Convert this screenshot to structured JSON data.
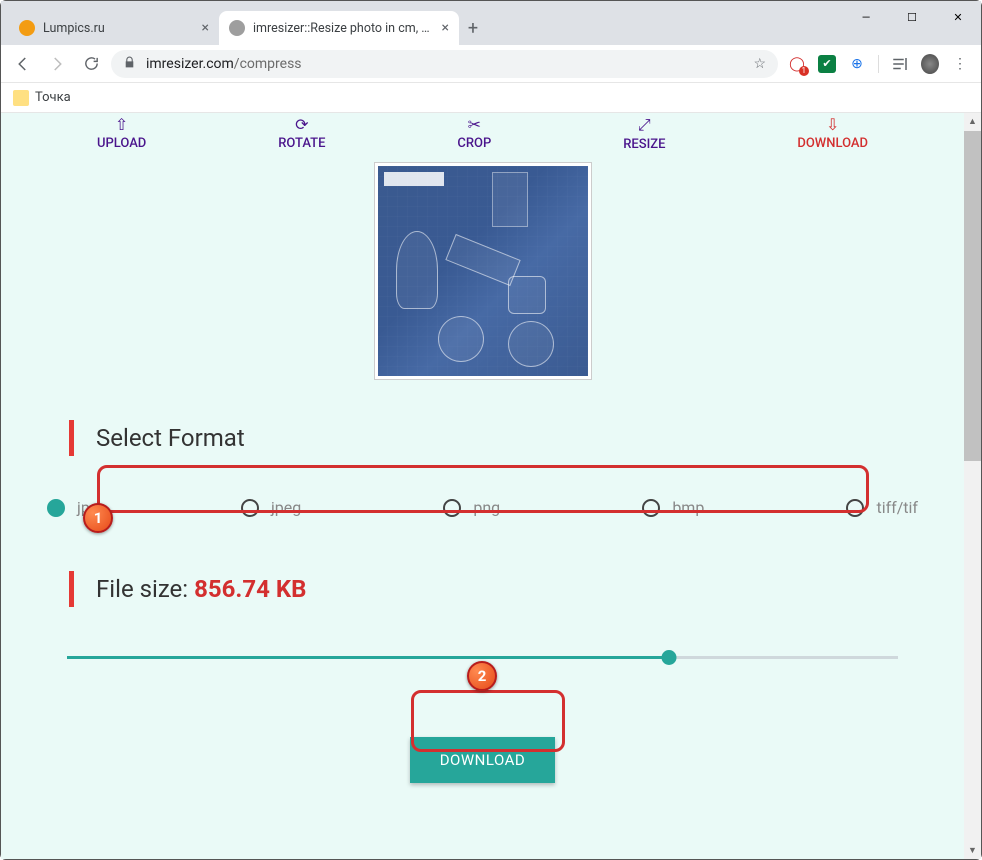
{
  "window": {
    "min": "—",
    "max": "☐",
    "close": "✕"
  },
  "tabs": [
    {
      "title": "Lumpics.ru",
      "favicon": "#f39c12",
      "active": false
    },
    {
      "title": "imresizer::Resize photo in cm, mm",
      "favicon": "#9e9e9e",
      "active": true
    }
  ],
  "newtab": "+",
  "addressbar": {
    "host": "imresizer.com",
    "path": "/compress"
  },
  "bookmarks": [
    {
      "label": "Точка"
    }
  ],
  "steps": [
    {
      "key": "upload",
      "label": "UPLOAD",
      "icon": "⇧"
    },
    {
      "key": "rotate",
      "label": "ROTATE",
      "icon": "⟳"
    },
    {
      "key": "crop",
      "label": "CROP",
      "icon": "✂"
    },
    {
      "key": "resize",
      "label": "RESIZE",
      "icon": "⤢"
    },
    {
      "key": "download",
      "label": "DOWNLOAD",
      "icon": "⇩",
      "active": true
    }
  ],
  "select_format_heading": "Select Format",
  "formats": [
    {
      "label": "jpg",
      "checked": true
    },
    {
      "label": "jpeg",
      "checked": false
    },
    {
      "label": "png",
      "checked": false
    },
    {
      "label": "bmp",
      "checked": false
    },
    {
      "label": "tiff/tif",
      "checked": false
    }
  ],
  "filesize": {
    "label": "File size: ",
    "value": "856.74 KB"
  },
  "slider": {
    "percent": 72.5
  },
  "download_button": "DOWNLOAD",
  "callouts": {
    "one": "1",
    "two": "2"
  }
}
